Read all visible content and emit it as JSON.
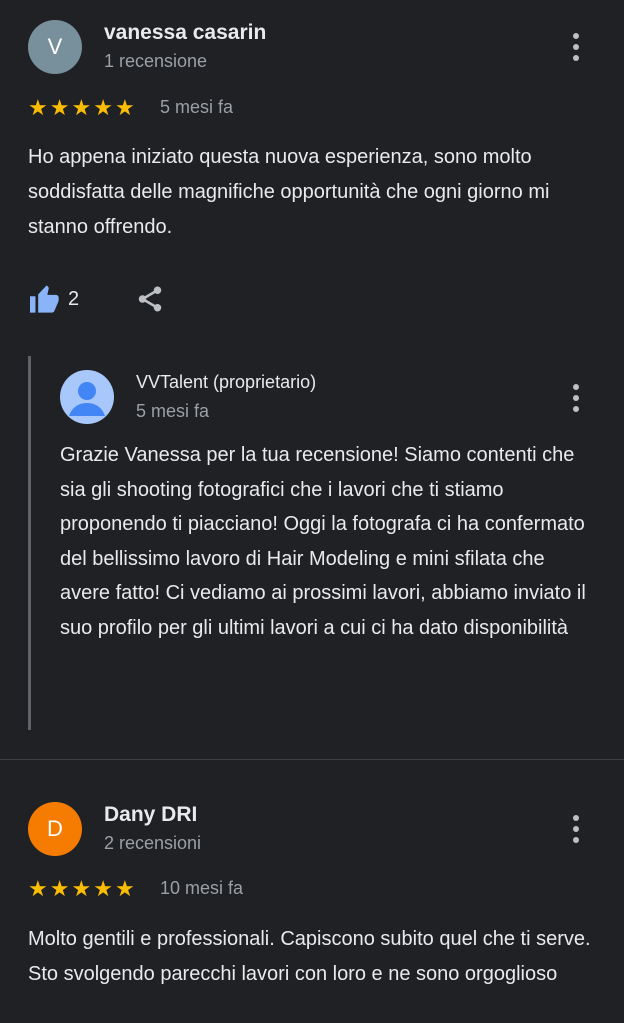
{
  "reviews": [
    {
      "avatar_letter": "V",
      "avatar_color": "#78909c",
      "name": "vanessa casarin",
      "count": "1 recensione",
      "stars": 5,
      "time": "5 mesi fa",
      "text": "Ho appena iniziato questa nuova esperienza, sono molto soddisfatta delle magnifiche opportunità che ogni giorno mi stanno offrendo.",
      "likes": "2",
      "reply": {
        "owner": "VVTalent (proprietario)",
        "time": "5 mesi fa",
        "text": "Grazie Vanessa per la tua recensione! Siamo contenti che sia gli shooting fotografici che i lavori che ti stiamo proponendo ti piacciano! Oggi la fotografa ci ha confermato del bellissimo lavoro di Hair Modeling e mini sfilata che avere fatto! Ci vediamo ai prossimi lavori, abbiamo inviato il suo profilo per gli ultimi lavori a cui ci ha dato disponibilità"
      }
    },
    {
      "avatar_letter": "D",
      "avatar_color": "#f57c00",
      "name": "Dany DRI",
      "count": "2 recensioni",
      "stars": 5,
      "time": "10 mesi fa",
      "text": "Molto gentili e professionali. Capiscono subito quel che ti serve. Sto svolgendo parecchi lavori con loro e ne sono orgoglioso"
    }
  ],
  "icons": {
    "star": "star-icon",
    "like": "thumb-up-icon",
    "share": "share-icon",
    "more": "more-vert-icon",
    "owner_avatar": "person-avatar-icon"
  },
  "colors": {
    "accent_blue": "#8ab4f8",
    "star": "#fbbc04"
  }
}
